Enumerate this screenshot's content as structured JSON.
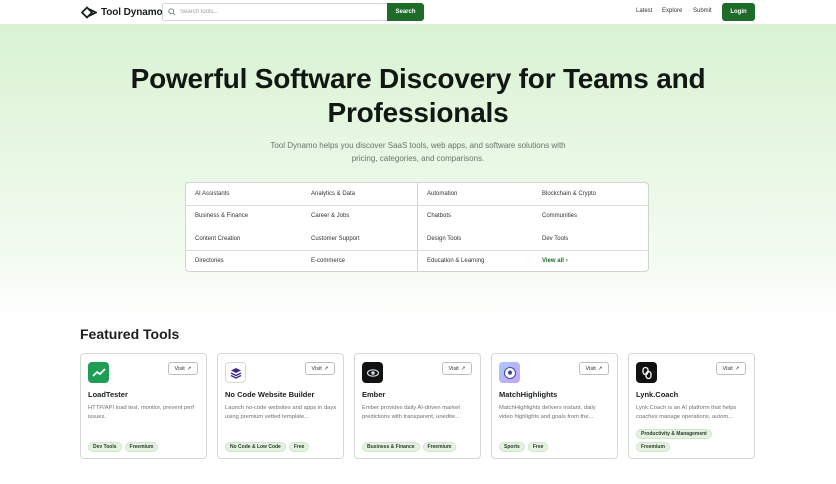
{
  "header": {
    "logo_text": "Tool Dynamo",
    "search_placeholder": "Search tools...",
    "search_button": "Search",
    "nav": [
      "Latest",
      "Explore",
      "Submit"
    ],
    "login": "Login"
  },
  "hero": {
    "title_line1": "Powerful Software Discovery for Teams and",
    "title_line2": "Professionals",
    "subtitle_line1": "Tool Dynamo helps you discover SaaS tools, web apps, and software solutions with",
    "subtitle_line2": "pricing, categories, and comparisons."
  },
  "categories": [
    "AI Assistants",
    "Analytics & Data",
    "Automation",
    "Blockchain & Crypto",
    "Business & Finance",
    "Career & Jobs",
    "Chatbots",
    "Communities",
    "Content Creation",
    "Customer Support",
    "Design Tools",
    "Dev Tools",
    "Directories",
    "E-commerce",
    "Education & Learning",
    "View all"
  ],
  "featured": {
    "title": "Featured Tools",
    "visit_label": "Visit",
    "cards": [
      {
        "name": "LoadTester",
        "desc": "HTTP/API load test, monitor, prevent perf issues.",
        "tags": [
          "Dev Tools",
          "Freemium"
        ],
        "icon": "chart-trend-icon",
        "icon_bg": "#1f9d55"
      },
      {
        "name": "No Code Website Builder",
        "desc": "Launch no-code websites and apps in days using premium vetted template...",
        "tags": [
          "No Code & Low Code",
          "Free"
        ],
        "icon": "layers-icon",
        "icon_bg": "#ffffff"
      },
      {
        "name": "Ember",
        "desc": "Ember provides daily AI-driven market predictions with transparent, unedite...",
        "tags": [
          "Business & Finance",
          "Freemium"
        ],
        "icon": "ember-eye-icon",
        "icon_bg": "#111111"
      },
      {
        "name": "MatchHighlights",
        "desc": "MatchHighlights delivers instant, daily video highlights and goals from the...",
        "tags": [
          "Sports",
          "Free"
        ],
        "icon": "soccer-ball-icon",
        "icon_bg": "#7fb0ff"
      },
      {
        "name": "Lynk.Coach",
        "desc": "Lynk.Coach is an AI platform that helps coaches manage operations, autom...",
        "tags": [
          "Productivity & Management",
          "Freemium"
        ],
        "icon": "link-icon",
        "icon_bg": "#111111"
      }
    ]
  },
  "colors": {
    "brand_green": "#1e6b2a",
    "tag_bg": "#e3f3df"
  }
}
